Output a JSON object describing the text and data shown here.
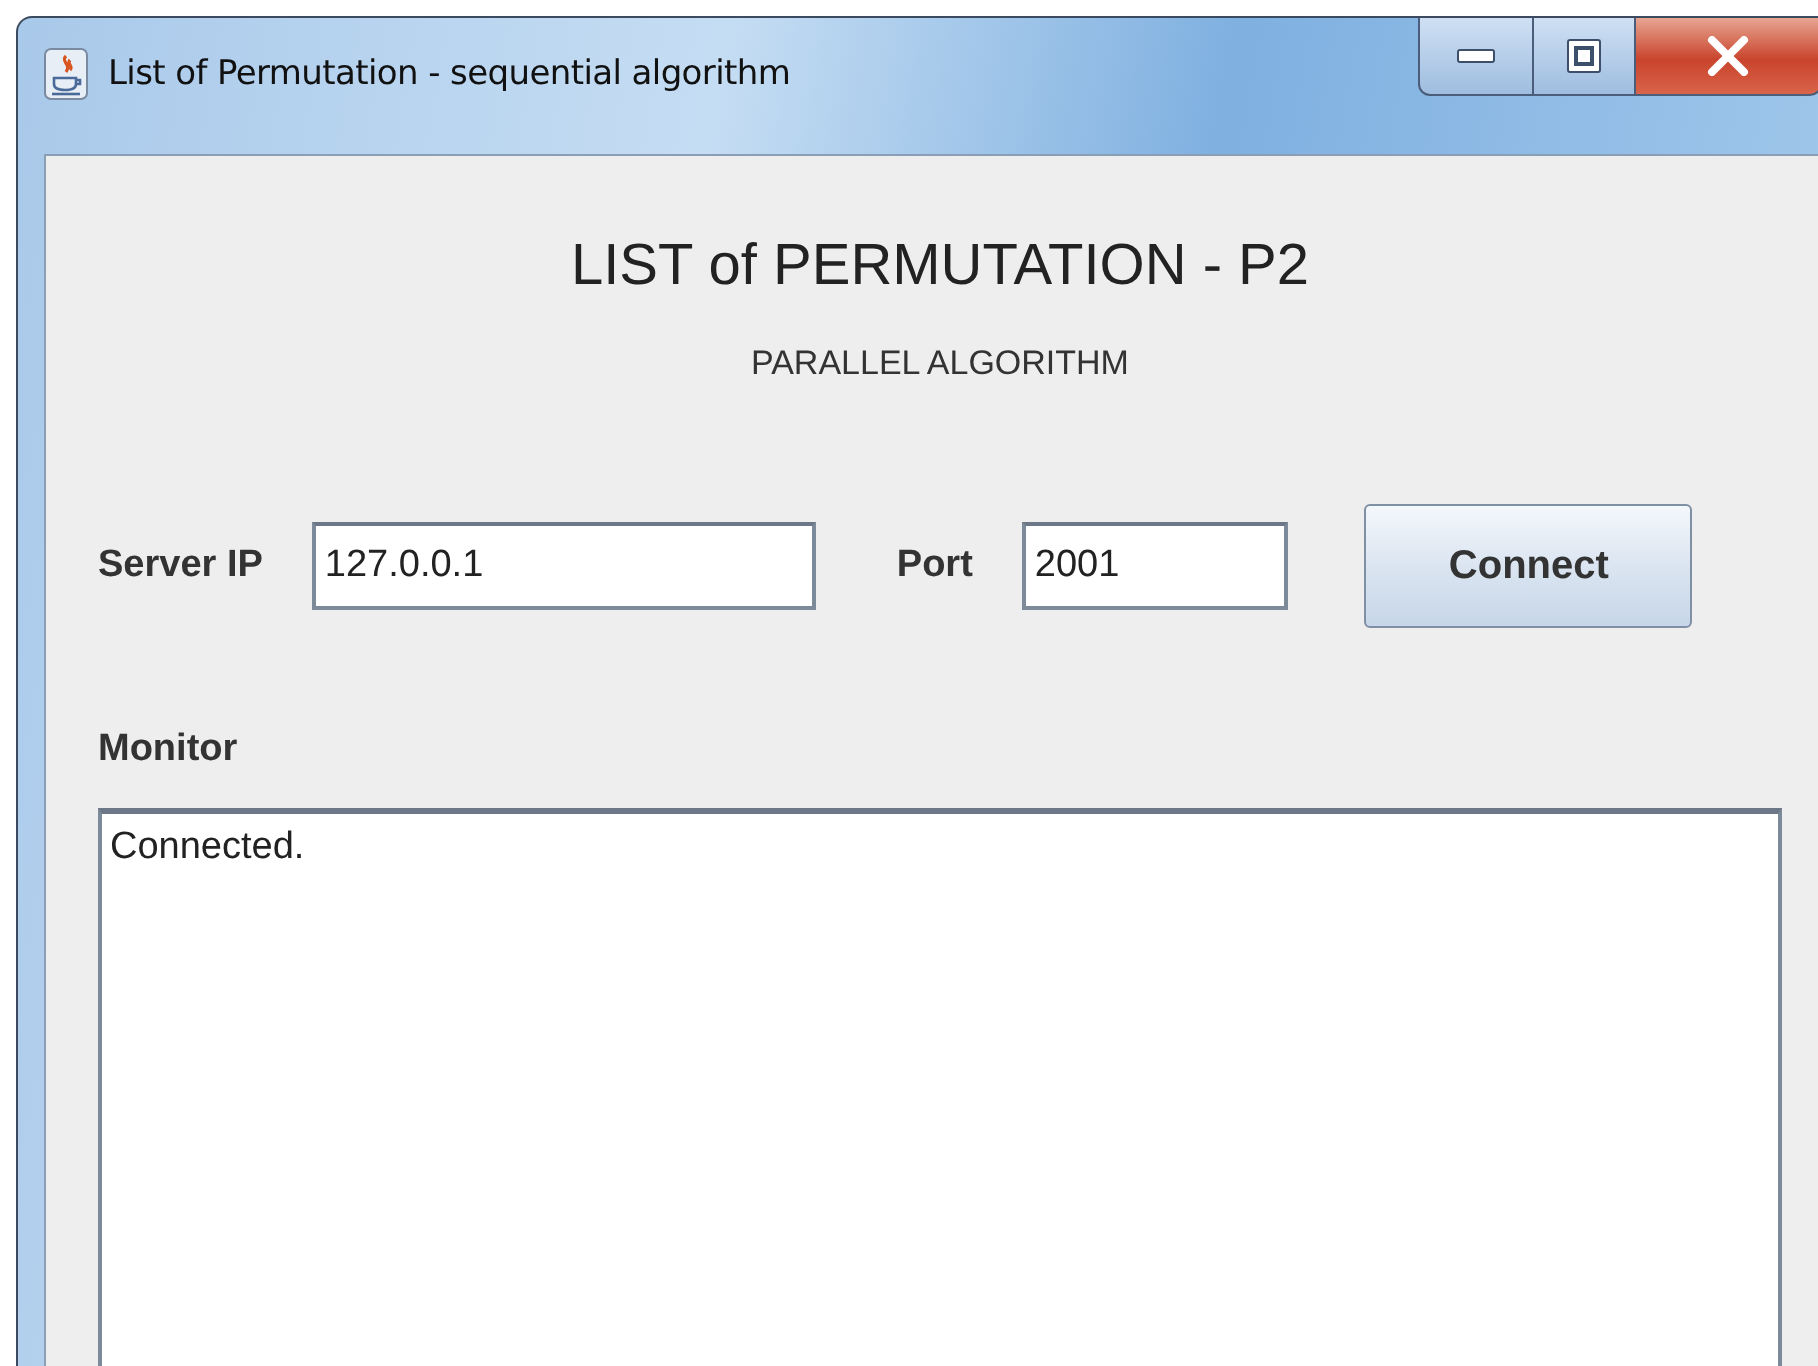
{
  "window": {
    "title": "List of Permutation - sequential algorithm"
  },
  "heading": "LIST of PERMUTATION - P2",
  "subheading": "PARALLEL ALGORITHM",
  "server_ip": {
    "label": "Server IP",
    "value": "127.0.0.1"
  },
  "port": {
    "label": "Port",
    "value": "2001"
  },
  "connect_button": "Connect",
  "monitor": {
    "label": "Monitor",
    "text": "Connected."
  }
}
